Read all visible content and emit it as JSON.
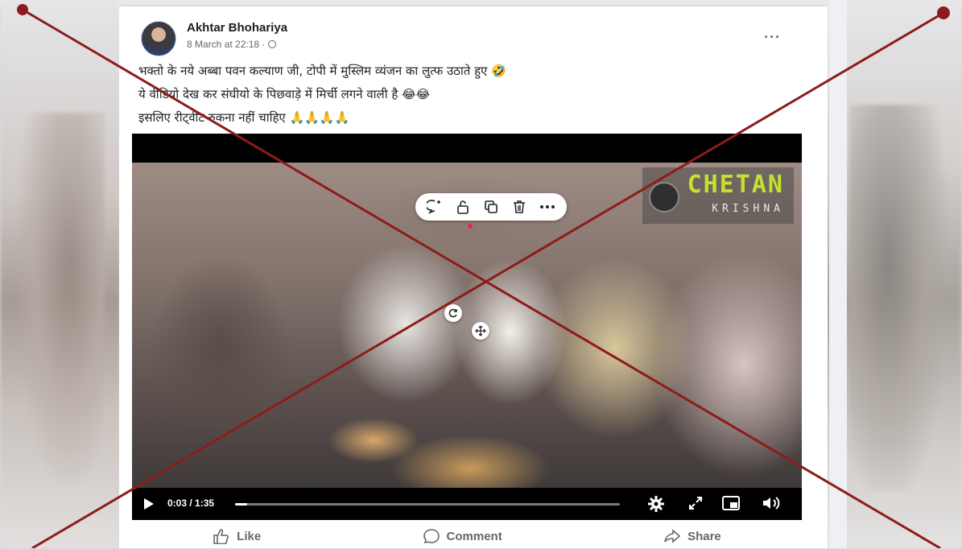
{
  "post": {
    "author": "Akhtar Bhohariya",
    "timestamp": "8 March at 22:18 ·",
    "caption_lines": [
      "भक्तो के नये अब्बा पवन कल्याण जी, टोपी में मुस्लिम व्यंजन का लुत्फ उठाते हुए 🤣",
      "ये वीडियो देख कर संघीयो के पिछवाड़े में मिर्ची लगने वाली है 😂😂",
      "इसलिए रीट्वीट रुकना नहीं चाहिए 🙏🙏🙏🙏"
    ]
  },
  "video": {
    "watermark_title": "CHETAN",
    "watermark_subtitle": "KRISHNA",
    "time_display": "0:03 / 1:35",
    "progress": 0.032
  },
  "actions": {
    "like": "Like",
    "comment": "Comment",
    "share": "Share"
  },
  "icons": {
    "play": "play-icon",
    "settings": "gear-icon",
    "expand": "expand-icon",
    "pip": "picture-in-picture-icon",
    "volume": "volume-icon",
    "globe": "globe-icon"
  },
  "colors": {
    "cross_mark": "#8c1c1c",
    "watermark": "#c6e030"
  }
}
